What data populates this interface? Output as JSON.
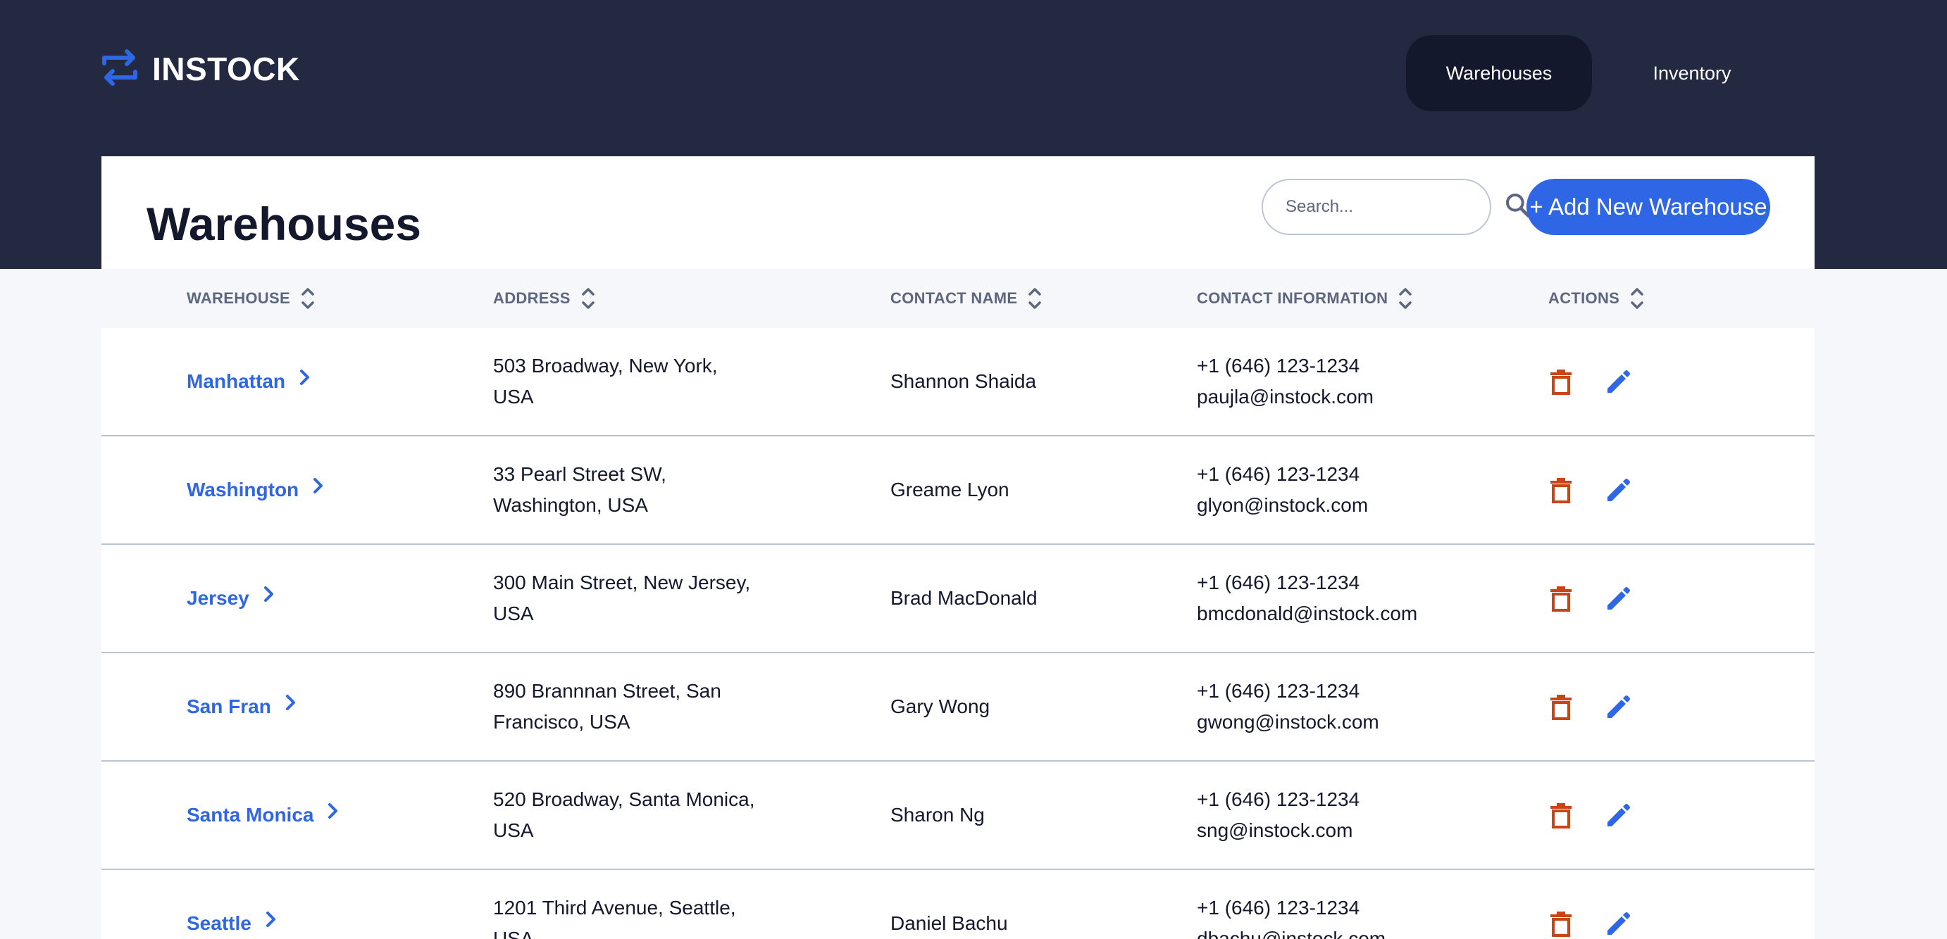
{
  "app": {
    "logo_text": "INSTOCK",
    "colors": {
      "header_bg": "#232940",
      "accent": "#2e66e5",
      "danger": "#c94515",
      "text": "#13182c",
      "muted": "#5c667e"
    }
  },
  "nav": {
    "items": [
      {
        "label": "Warehouses",
        "active": true
      },
      {
        "label": "Inventory",
        "active": false
      }
    ]
  },
  "page": {
    "title": "Warehouses",
    "search_placeholder": "Search...",
    "add_button_label": "+ Add New Warehouse"
  },
  "table": {
    "columns": [
      "WAREHOUSE",
      "ADDRESS",
      "CONTACT NAME",
      "CONTACT INFORMATION",
      "ACTIONS"
    ],
    "rows": [
      {
        "warehouse": "Manhattan",
        "address_line1": "503 Broadway, New York,",
        "address_line2": "USA",
        "contact_name": "Shannon Shaida",
        "phone": "+1 (646) 123-1234",
        "email": "paujla@instock.com"
      },
      {
        "warehouse": "Washington",
        "address_line1": "33 Pearl Street SW,",
        "address_line2": "Washington, USA",
        "contact_name": "Greame Lyon",
        "phone": "+1 (646) 123-1234",
        "email": "glyon@instock.com"
      },
      {
        "warehouse": "Jersey",
        "address_line1": "300 Main Street, New Jersey,",
        "address_line2": "USA",
        "contact_name": "Brad MacDonald",
        "phone": "+1 (646) 123-1234",
        "email": "bmcdonald@instock.com"
      },
      {
        "warehouse": "San Fran",
        "address_line1": "890 Brannnan Street, San",
        "address_line2": "Francisco, USA",
        "contact_name": "Gary Wong",
        "phone": "+1 (646) 123-1234",
        "email": "gwong@instock.com"
      },
      {
        "warehouse": "Santa Monica",
        "address_line1": "520 Broadway, Santa Monica,",
        "address_line2": "USA",
        "contact_name": "Sharon Ng",
        "phone": "+1 (646) 123-1234",
        "email": "sng@instock.com"
      },
      {
        "warehouse": "Seattle",
        "address_line1": "1201 Third Avenue, Seattle,",
        "address_line2": "USA",
        "contact_name": "Daniel Bachu",
        "phone": "+1 (646) 123-1234",
        "email": "dbachu@instock.com"
      }
    ],
    "icons": {
      "sort": "sort-icon",
      "chevron": "chevron-right-icon",
      "delete": "trash-icon",
      "edit": "pencil-icon"
    }
  }
}
